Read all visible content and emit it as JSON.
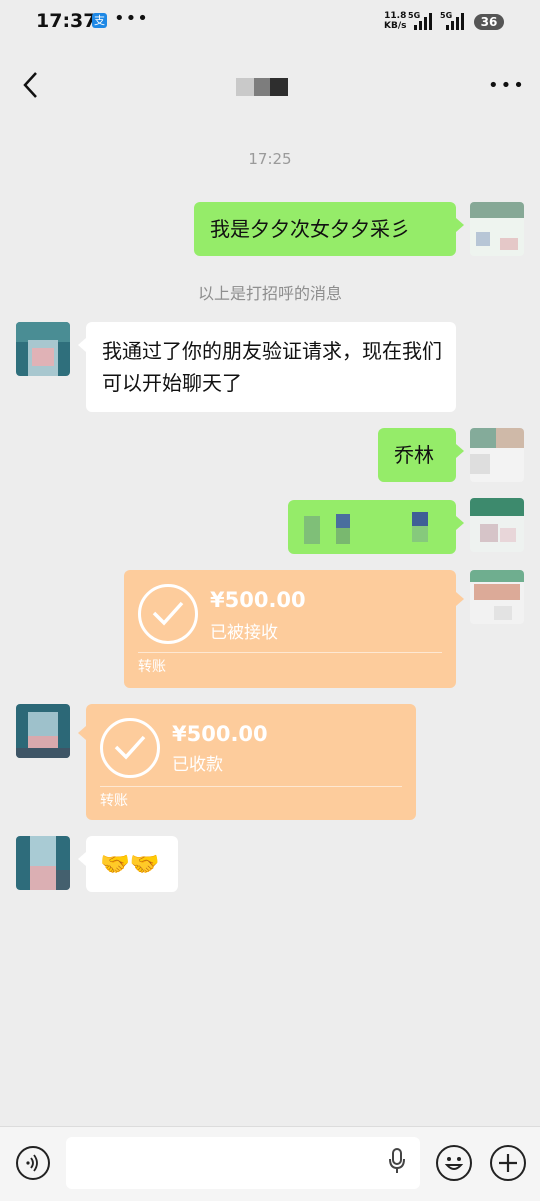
{
  "status_bar": {
    "time": "17:37",
    "app_icon_char": "支",
    "dots": "•••",
    "speed_value": "11.8",
    "speed_unit": "KB/s",
    "net1": "5G",
    "net2": "5G",
    "battery": "36"
  },
  "nav": {
    "back_icon": "chevron-left-icon",
    "more_icon": "more-dots-icon",
    "more_text": "•••"
  },
  "chat": {
    "timestamp": "17:25",
    "system_message": "以上是打招呼的消息",
    "messages": {
      "m1": {
        "text": "我是夕夕次女夕夕采彡"
      },
      "m2": {
        "text": "我通过了你的朋友验证请求，现在我们可以开始聊天了"
      },
      "m3": {
        "text": "乔林"
      },
      "t1": {
        "amount": "¥500.00",
        "status": "已被接收",
        "label": "转账"
      },
      "t2": {
        "amount": "¥500.00",
        "status": "已收款",
        "label": "转账"
      },
      "m5": {
        "text": "🤝🤝"
      }
    }
  },
  "colors": {
    "background": "#ededed",
    "green_bubble": "#95ec69",
    "transfer": "#fdcc9c"
  }
}
